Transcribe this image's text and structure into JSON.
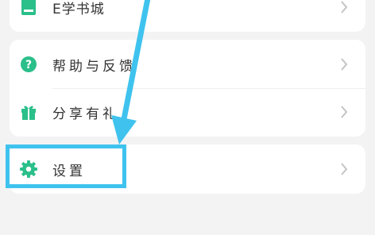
{
  "menu": {
    "items": [
      {
        "label": "E学书城",
        "icon": "book-icon"
      },
      {
        "label": "帮助与反馈",
        "icon": "help-icon"
      },
      {
        "label": "分享有礼",
        "icon": "gift-icon"
      },
      {
        "label": "设置",
        "icon": "gear-icon"
      }
    ]
  },
  "annotation": {
    "color": "#3fc3ee",
    "target": "设置"
  },
  "colors": {
    "icon_green": "#2bbf8a",
    "background": "#f3f3f4",
    "chevron": "#c4c4c4"
  }
}
